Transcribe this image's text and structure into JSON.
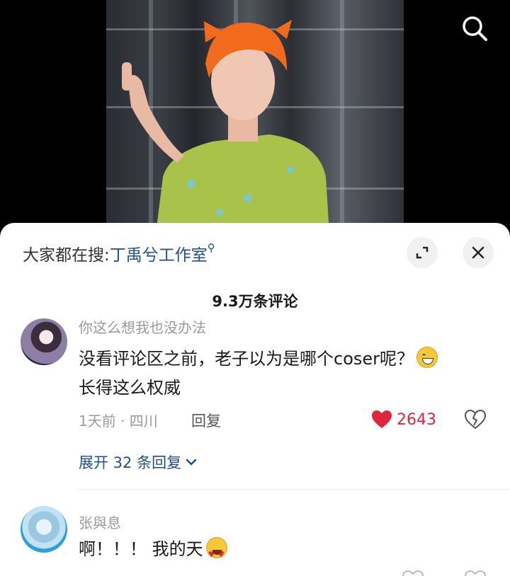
{
  "video": {
    "search_icon": "search-icon"
  },
  "sheet": {
    "trending_prefix": "大家都在搜:",
    "trending_keyword": "丁禹兮工作室",
    "expand_icon": "expand-icon",
    "close_icon": "close-icon",
    "comment_count": "9.3万条评论"
  },
  "comments": [
    {
      "username": "你这么想我也没办法",
      "text": "没看评论区之前，老子以为是哪个coser呢？",
      "text_line2": "长得这么权威",
      "emoji": "grinning-face",
      "time_location": "1天前 · 四川",
      "reply_label": "回复",
      "likes": "2643",
      "liked": true,
      "expand_replies": "展开 32 条回复"
    },
    {
      "username": "张與息",
      "text": "啊！！！ 我的天",
      "emoji": "heart-eyes-face"
    }
  ],
  "colors": {
    "accent_blue": "#1f4f8f",
    "like_red": "#e0263d"
  }
}
